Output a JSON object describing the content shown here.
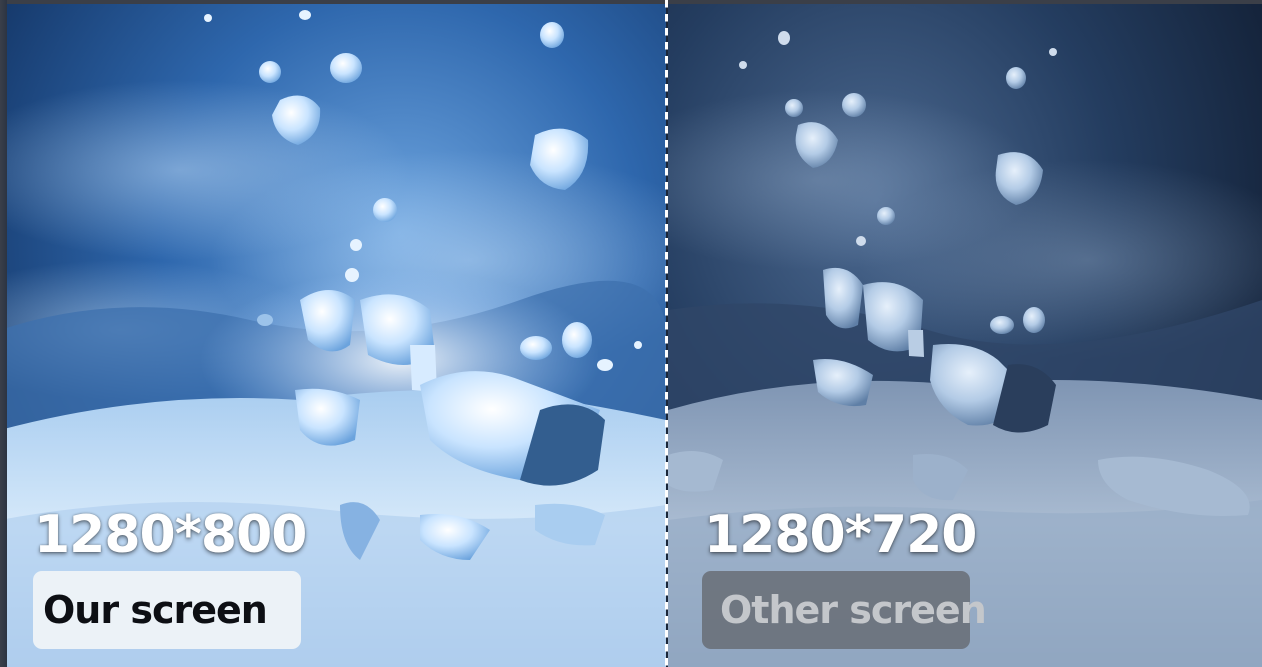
{
  "comparison": {
    "left": {
      "resolution": "1280*800",
      "label": "Our screen"
    },
    "right": {
      "resolution": "1280*720",
      "label": "Other screen"
    }
  },
  "colors": {
    "left_sky": "#1f4f8f",
    "right_sky": "#1b2b45",
    "snow_left": "#cfe3f7",
    "snow_right": "#9fb3cc",
    "divider": "#ffffff"
  }
}
